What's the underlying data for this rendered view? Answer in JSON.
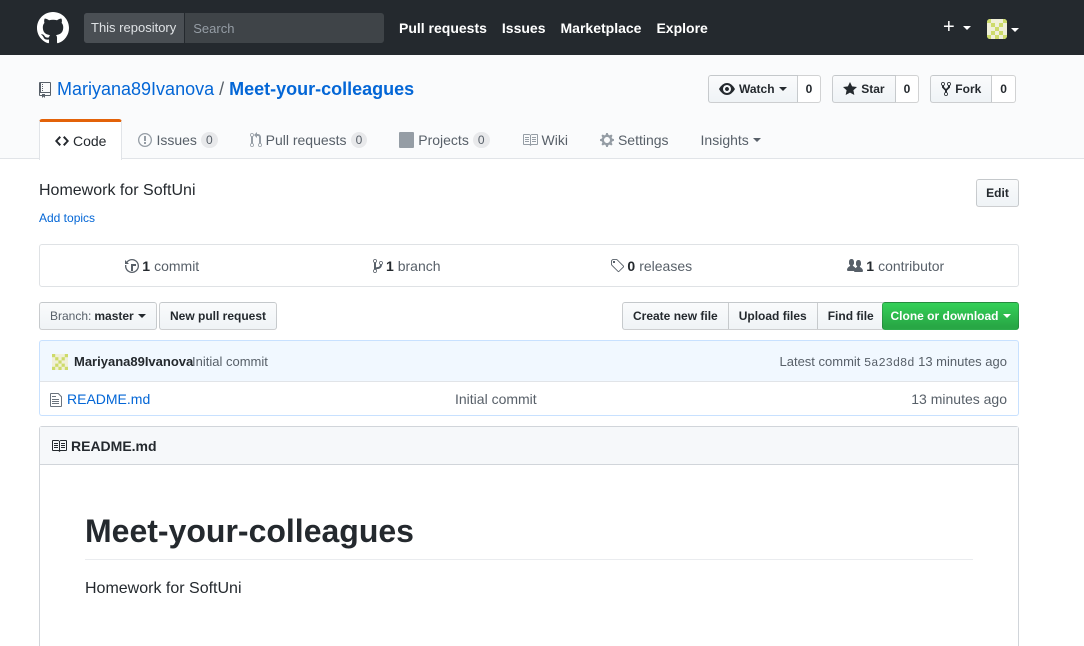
{
  "header": {
    "scope_label": "This repository",
    "search_placeholder": "Search",
    "nav": [
      "Pull requests",
      "Issues",
      "Marketplace",
      "Explore"
    ],
    "plus": "+"
  },
  "repo": {
    "owner": "Mariyana89Ivanova",
    "separator": "/",
    "name": "Meet-your-colleagues",
    "actions": {
      "watch_label": "Watch",
      "watch_count": "0",
      "star_label": "Star",
      "star_count": "0",
      "fork_label": "Fork",
      "fork_count": "0"
    },
    "tabs": {
      "code": "Code",
      "issues": "Issues",
      "issues_count": "0",
      "pulls": "Pull requests",
      "pulls_count": "0",
      "projects": "Projects",
      "projects_count": "0",
      "wiki": "Wiki",
      "settings": "Settings",
      "insights": "Insights"
    }
  },
  "content": {
    "description": "Homework for SoftUni",
    "add_topics": "Add topics",
    "edit_label": "Edit",
    "summary": {
      "commits_num": "1",
      "commits_label": "commit",
      "branches_num": "1",
      "branches_label": "branch",
      "releases_num": "0",
      "releases_label": "releases",
      "contributors_num": "1",
      "contributors_label": "contributor"
    },
    "file_nav": {
      "branch_prefix": "Branch:",
      "branch_name": "master",
      "new_pr": "New pull request",
      "create_file": "Create new file",
      "upload_files": "Upload files",
      "find_file": "Find file",
      "clone": "Clone or download"
    },
    "commit": {
      "author": "Mariyana89Ivanova",
      "message": "Initial commit",
      "latest_label": "Latest commit",
      "sha": "5a23d8d",
      "age": "13 minutes ago"
    },
    "files": [
      {
        "name": "README.md",
        "message": "Initial commit",
        "age": "13 minutes ago"
      }
    ],
    "readme": {
      "title": "README.md",
      "h1": "Meet-your-colleagues",
      "body": "Homework for SoftUni"
    }
  },
  "colors": {
    "header_bg": "#24292e",
    "link": "#0366d6",
    "clone_green": "#28a745",
    "tab_accent": "#e36209"
  }
}
